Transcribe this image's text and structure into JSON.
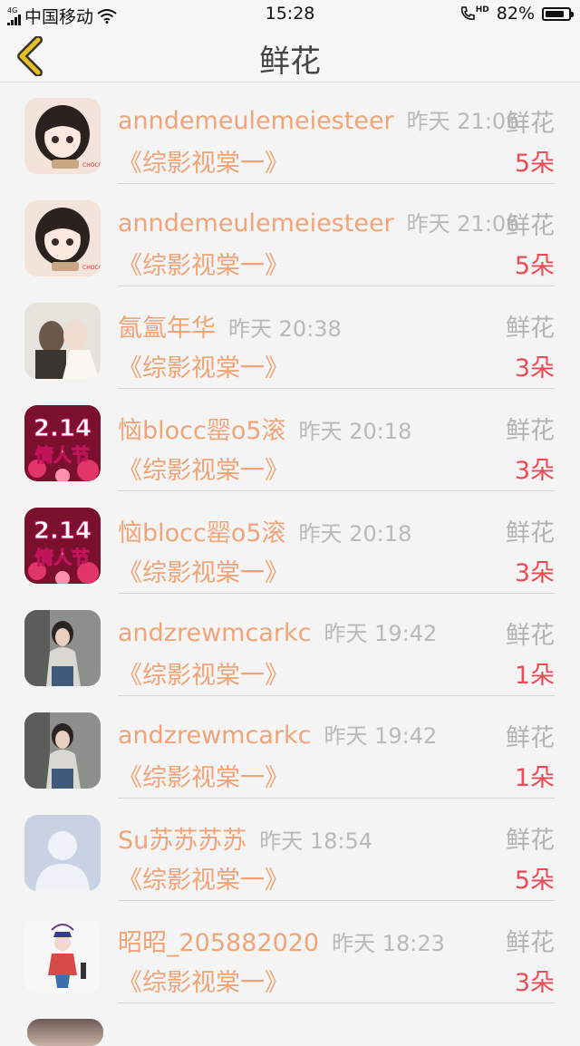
{
  "status_bar": {
    "network_tag": "4G",
    "carrier": "中国移动",
    "time": "15:28",
    "hd_label": "HD",
    "battery_percent": "82%",
    "battery_level": 0.82
  },
  "header": {
    "title": "鲜花"
  },
  "rows": [
    {
      "name": "anndemeulemeiesteer",
      "time": "昨天 21:06",
      "gift": "鲜花",
      "work": "《综影视棠一》",
      "count": "5朵",
      "avatar": "cartoon-girl"
    },
    {
      "name": "anndemeulemeiesteer",
      "time": "昨天 21:06",
      "gift": "鲜花",
      "work": "《综影视棠一》",
      "count": "5朵",
      "avatar": "cartoon-girl"
    },
    {
      "name": "氤氲年华",
      "time": "昨天 20:38",
      "gift": "鲜花",
      "work": "《综影视棠一》",
      "count": "3朵",
      "avatar": "couple-photo"
    },
    {
      "name": "恼blocc罂o5滚",
      "time": "昨天 20:18",
      "gift": "鲜花",
      "work": "《综影视棠一》",
      "count": "3朵",
      "avatar": "valentine-214"
    },
    {
      "name": "恼blocc罂o5滚",
      "time": "昨天 20:18",
      "gift": "鲜花",
      "work": "《综影视棠一》",
      "count": "3朵",
      "avatar": "valentine-214"
    },
    {
      "name": "andzrewmcarkc",
      "time": "昨天 19:42",
      "gift": "鲜花",
      "work": "《综影视棠一》",
      "count": "1朵",
      "avatar": "person-photo"
    },
    {
      "name": "andzrewmcarkc",
      "time": "昨天 19:42",
      "gift": "鲜花",
      "work": "《综影视棠一》",
      "count": "1朵",
      "avatar": "person-photo"
    },
    {
      "name": "Su苏苏苏苏",
      "time": "昨天 18:54",
      "gift": "鲜花",
      "work": "《综影视棠一》",
      "count": "5朵",
      "avatar": "default-user"
    },
    {
      "name": "昭昭_205882020",
      "time": "昨天 18:23",
      "gift": "鲜花",
      "work": "《综影视棠一》",
      "count": "3朵",
      "avatar": "opera-figure"
    }
  ],
  "valentine_text": {
    "top": "2.14",
    "bottom": "情人节"
  },
  "colors": {
    "accent": "#f0a478",
    "count": "#ee4a55",
    "back_arrow": "#e8c020"
  }
}
